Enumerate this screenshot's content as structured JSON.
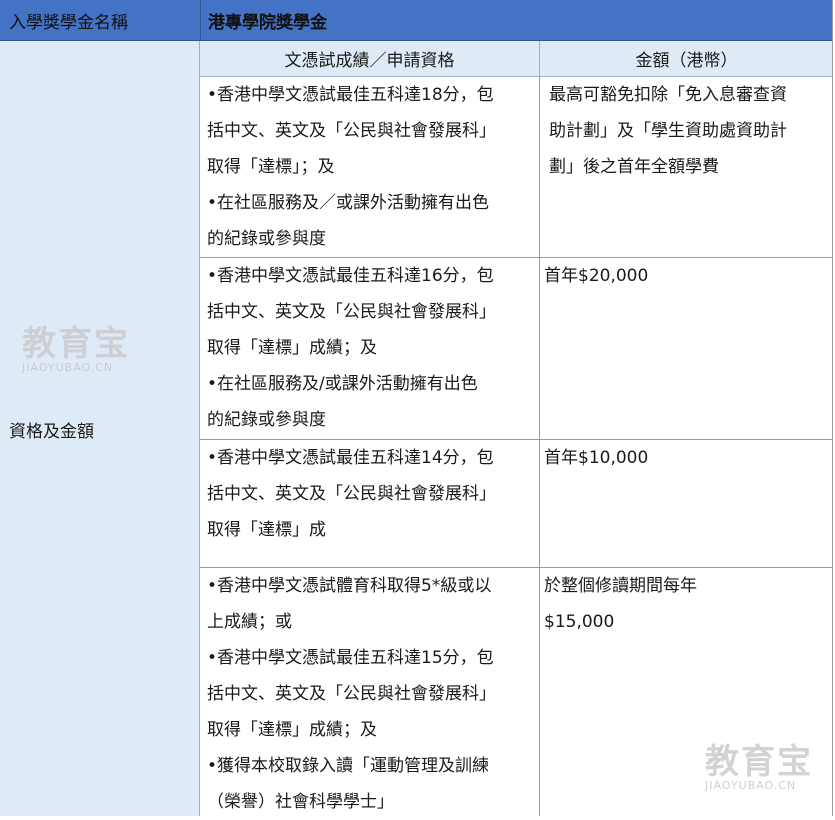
{
  "header": {
    "label": "入學獎學金名稱",
    "value": "港專學院獎學金"
  },
  "left": {
    "label": "資格及金額"
  },
  "columns": {
    "requirement": "文憑試成績／申請資格",
    "amount": "金額（港幣）"
  },
  "rows": [
    {
      "requirement": [
        "•香港中學文憑試最佳五科達18分，包",
        "括中文、英文及「公民與社會發展科」",
        "取得「達標」；及",
        "•在社區服務及／或課外活動擁有出色",
        "的紀錄或參與度"
      ],
      "amount": [
        "最高可豁免扣除「免入息審查資",
        "助計劃」及「學生資助處資助計",
        "劃」後之首年全額學費"
      ]
    },
    {
      "requirement": [
        "•香港中學文憑試最佳五科達16分，包",
        "括中文、英文及「公民與社會發展科」",
        "取得「達標」成績；及",
        "•在社區服務及/或課外活動擁有出色",
        "的紀錄或參與度"
      ],
      "amount": [
        "首年$20,000"
      ]
    },
    {
      "requirement": [
        "•香港中學文憑試最佳五科達14分，包",
        "括中文、英文及「公民與社會發展科」",
        "取得「達標」成"
      ],
      "amount": [
        "首年$10,000"
      ]
    },
    {
      "requirement": [
        "•香港中學文憑試體育科取得5*級或以",
        "上成績；或",
        "•香港中學文憑試最佳五科達15分，包",
        "括中文、英文及「公民與社會發展科」",
        "取得「達標」成績；及",
        "•獲得本校取錄入讀「運動管理及訓練",
        "（榮譽）社會科學學士」"
      ],
      "amount": [
        "於整個修讀期間每年",
        "$15,000"
      ]
    }
  ],
  "watermark": {
    "text": "教育宝",
    "url": "JIAOYUBAO.CN"
  }
}
